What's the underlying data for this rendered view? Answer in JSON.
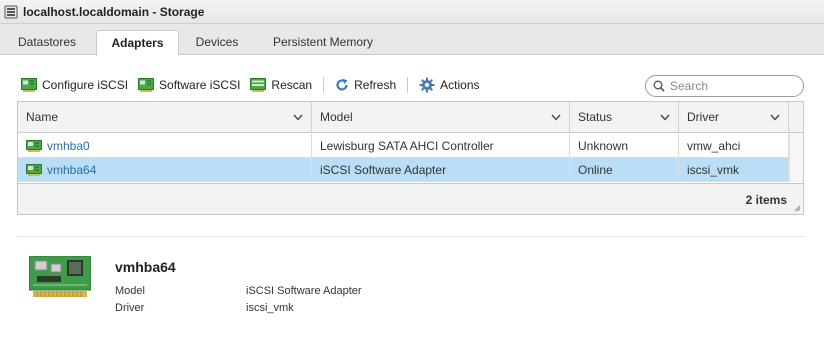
{
  "window": {
    "title": "localhost.localdomain - Storage",
    "icon": "storage-icon"
  },
  "tabs": [
    {
      "label": "Datastores",
      "active": false
    },
    {
      "label": "Adapters",
      "active": true
    },
    {
      "label": "Devices",
      "active": false
    },
    {
      "label": "Persistent Memory",
      "active": false
    }
  ],
  "toolbar": {
    "configure_iscsi": {
      "label": "Configure iSCSI",
      "icon": "adapter-icon"
    },
    "software_iscsi": {
      "label": "Software iSCSI",
      "icon": "adapter-icon"
    },
    "rescan": {
      "label": "Rescan",
      "icon": "rescan-icon"
    },
    "refresh": {
      "label": "Refresh",
      "icon": "refresh-icon"
    },
    "actions": {
      "label": "Actions",
      "icon": "gear-icon"
    }
  },
  "search": {
    "placeholder": "Search",
    "value": ""
  },
  "grid": {
    "columns": [
      "Name",
      "Model",
      "Status",
      "Driver"
    ],
    "rows": [
      {
        "name": "vmhba0",
        "model": "Lewisburg SATA AHCI Controller",
        "status": "Unknown",
        "driver": "vmw_ahci",
        "selected": false
      },
      {
        "name": "vmhba64",
        "model": "iSCSI Software Adapter",
        "status": "Online",
        "driver": "iscsi_vmk",
        "selected": true
      }
    ],
    "item_count": "2 items"
  },
  "detail": {
    "title": "vmhba64",
    "icon": "adapter-card-icon",
    "fields": [
      {
        "key": "Model",
        "value": "iSCSI Software Adapter"
      },
      {
        "key": "Driver",
        "value": "iscsi_vmk"
      }
    ]
  },
  "colors": {
    "selected_row": "#b9def5",
    "link": "#2a6ea8",
    "refresh_blue": "#2f7fc1",
    "adapter_green": "#3c9b3c"
  }
}
